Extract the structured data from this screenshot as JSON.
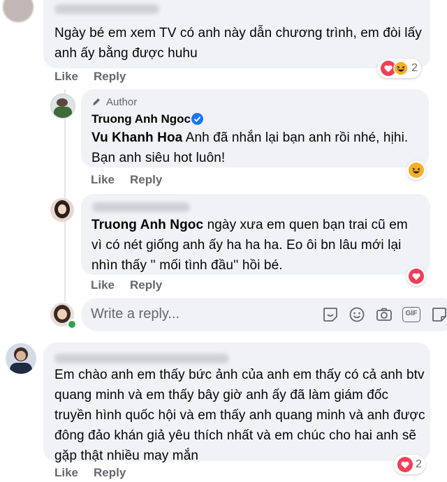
{
  "comments": [
    {
      "text": "Ngày bé em xem TV có anh này dẫn chương trình, em đòi lấy anh ấy bằng được huhu",
      "like": "Like",
      "reply": "Reply",
      "reaction_count": "2",
      "reaction_icons": [
        "love-icon",
        "haha-icon"
      ]
    },
    {
      "author_badge": "Author",
      "author": "Truong Anh Ngoc",
      "tag": "Vu Khanh Hoa",
      "text": "Anh đã nhắn lại bạn anh rồi nhé, hịhi. Bạn anh siêu hot luôn!",
      "like": "Like",
      "reply": "Reply",
      "reaction_icons": [
        "haha-icon"
      ]
    },
    {
      "tag": "Truong Anh Ngoc",
      "text": "ngày xưa em quen bạn trai cũ em vì có nét giống anh ấy ha ha ha. Eo ôi bn lâu mới lại nhìn thấy '' mối tình đầu'' hồi bé.",
      "like": "Like",
      "reply": "Reply",
      "reaction_icons": [
        "love-icon"
      ]
    },
    {
      "text": "Em chào anh em thấy bức ảnh của anh em thấy có cả anh btv quang minh và em thấy bây giờ anh ấy đã làm giám đốc truyền hình quốc hội và em thấy anh quang minh và anh được đông đảo khán giả yêu thích nhất và em chúc cho hai anh sẽ gặp thật nhiều may mắn",
      "like": "Like",
      "reply": "Reply",
      "reaction_count": "2",
      "reaction_icons": [
        "love-icon"
      ]
    }
  ],
  "reply_box": {
    "placeholder": "Write a reply...",
    "icons": [
      "sticker-icon",
      "emoji-icon",
      "camera-icon",
      "gif-icon",
      "sticker-alt-icon"
    ],
    "gif_label": "GIF"
  },
  "colors": {
    "bubble": "#f0f2f5",
    "secondary_text": "#65676b",
    "verified": "#1877f2",
    "love": "#f33e58",
    "haha": "#f7b125"
  }
}
